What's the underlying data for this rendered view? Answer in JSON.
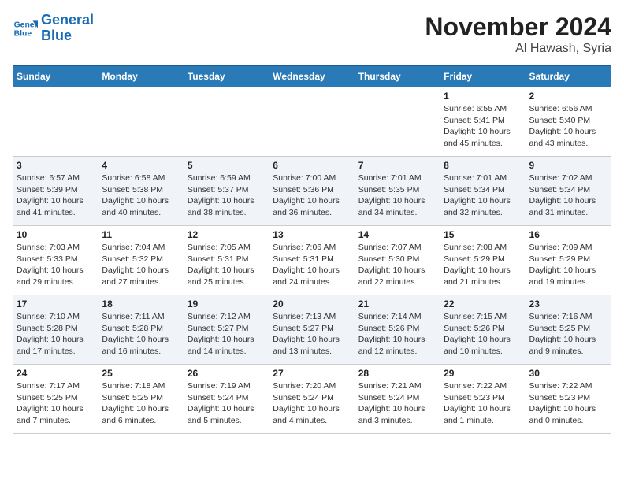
{
  "header": {
    "logo_line1": "General",
    "logo_line2": "Blue",
    "title": "November 2024",
    "subtitle": "Al Hawash, Syria"
  },
  "weekdays": [
    "Sunday",
    "Monday",
    "Tuesday",
    "Wednesday",
    "Thursday",
    "Friday",
    "Saturday"
  ],
  "weeks": [
    [
      {
        "day": "",
        "info": ""
      },
      {
        "day": "",
        "info": ""
      },
      {
        "day": "",
        "info": ""
      },
      {
        "day": "",
        "info": ""
      },
      {
        "day": "",
        "info": ""
      },
      {
        "day": "1",
        "info": "Sunrise: 6:55 AM\nSunset: 5:41 PM\nDaylight: 10 hours\nand 45 minutes."
      },
      {
        "day": "2",
        "info": "Sunrise: 6:56 AM\nSunset: 5:40 PM\nDaylight: 10 hours\nand 43 minutes."
      }
    ],
    [
      {
        "day": "3",
        "info": "Sunrise: 6:57 AM\nSunset: 5:39 PM\nDaylight: 10 hours\nand 41 minutes."
      },
      {
        "day": "4",
        "info": "Sunrise: 6:58 AM\nSunset: 5:38 PM\nDaylight: 10 hours\nand 40 minutes."
      },
      {
        "day": "5",
        "info": "Sunrise: 6:59 AM\nSunset: 5:37 PM\nDaylight: 10 hours\nand 38 minutes."
      },
      {
        "day": "6",
        "info": "Sunrise: 7:00 AM\nSunset: 5:36 PM\nDaylight: 10 hours\nand 36 minutes."
      },
      {
        "day": "7",
        "info": "Sunrise: 7:01 AM\nSunset: 5:35 PM\nDaylight: 10 hours\nand 34 minutes."
      },
      {
        "day": "8",
        "info": "Sunrise: 7:01 AM\nSunset: 5:34 PM\nDaylight: 10 hours\nand 32 minutes."
      },
      {
        "day": "9",
        "info": "Sunrise: 7:02 AM\nSunset: 5:34 PM\nDaylight: 10 hours\nand 31 minutes."
      }
    ],
    [
      {
        "day": "10",
        "info": "Sunrise: 7:03 AM\nSunset: 5:33 PM\nDaylight: 10 hours\nand 29 minutes."
      },
      {
        "day": "11",
        "info": "Sunrise: 7:04 AM\nSunset: 5:32 PM\nDaylight: 10 hours\nand 27 minutes."
      },
      {
        "day": "12",
        "info": "Sunrise: 7:05 AM\nSunset: 5:31 PM\nDaylight: 10 hours\nand 25 minutes."
      },
      {
        "day": "13",
        "info": "Sunrise: 7:06 AM\nSunset: 5:31 PM\nDaylight: 10 hours\nand 24 minutes."
      },
      {
        "day": "14",
        "info": "Sunrise: 7:07 AM\nSunset: 5:30 PM\nDaylight: 10 hours\nand 22 minutes."
      },
      {
        "day": "15",
        "info": "Sunrise: 7:08 AM\nSunset: 5:29 PM\nDaylight: 10 hours\nand 21 minutes."
      },
      {
        "day": "16",
        "info": "Sunrise: 7:09 AM\nSunset: 5:29 PM\nDaylight: 10 hours\nand 19 minutes."
      }
    ],
    [
      {
        "day": "17",
        "info": "Sunrise: 7:10 AM\nSunset: 5:28 PM\nDaylight: 10 hours\nand 17 minutes."
      },
      {
        "day": "18",
        "info": "Sunrise: 7:11 AM\nSunset: 5:28 PM\nDaylight: 10 hours\nand 16 minutes."
      },
      {
        "day": "19",
        "info": "Sunrise: 7:12 AM\nSunset: 5:27 PM\nDaylight: 10 hours\nand 14 minutes."
      },
      {
        "day": "20",
        "info": "Sunrise: 7:13 AM\nSunset: 5:27 PM\nDaylight: 10 hours\nand 13 minutes."
      },
      {
        "day": "21",
        "info": "Sunrise: 7:14 AM\nSunset: 5:26 PM\nDaylight: 10 hours\nand 12 minutes."
      },
      {
        "day": "22",
        "info": "Sunrise: 7:15 AM\nSunset: 5:26 PM\nDaylight: 10 hours\nand 10 minutes."
      },
      {
        "day": "23",
        "info": "Sunrise: 7:16 AM\nSunset: 5:25 PM\nDaylight: 10 hours\nand 9 minutes."
      }
    ],
    [
      {
        "day": "24",
        "info": "Sunrise: 7:17 AM\nSunset: 5:25 PM\nDaylight: 10 hours\nand 7 minutes."
      },
      {
        "day": "25",
        "info": "Sunrise: 7:18 AM\nSunset: 5:25 PM\nDaylight: 10 hours\nand 6 minutes."
      },
      {
        "day": "26",
        "info": "Sunrise: 7:19 AM\nSunset: 5:24 PM\nDaylight: 10 hours\nand 5 minutes."
      },
      {
        "day": "27",
        "info": "Sunrise: 7:20 AM\nSunset: 5:24 PM\nDaylight: 10 hours\nand 4 minutes."
      },
      {
        "day": "28",
        "info": "Sunrise: 7:21 AM\nSunset: 5:24 PM\nDaylight: 10 hours\nand 3 minutes."
      },
      {
        "day": "29",
        "info": "Sunrise: 7:22 AM\nSunset: 5:23 PM\nDaylight: 10 hours\nand 1 minute."
      },
      {
        "day": "30",
        "info": "Sunrise: 7:22 AM\nSunset: 5:23 PM\nDaylight: 10 hours\nand 0 minutes."
      }
    ]
  ]
}
